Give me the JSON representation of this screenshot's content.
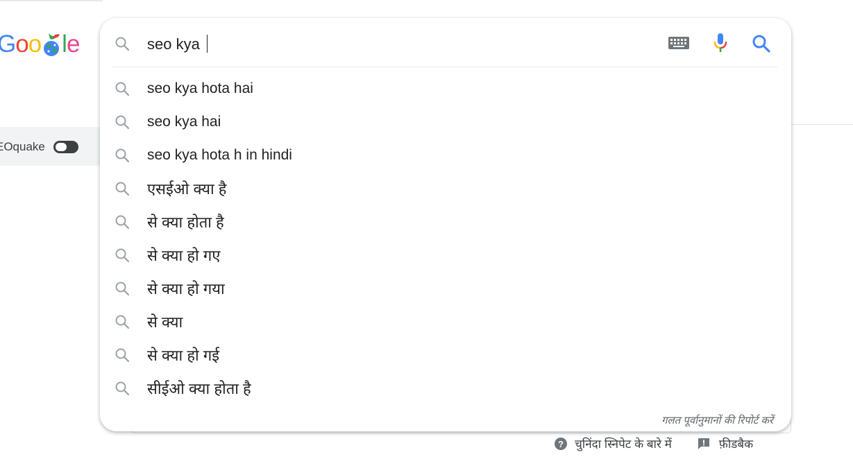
{
  "logo": {
    "g": "G",
    "o1": "o",
    "o2": "o",
    "l": "l",
    "e": "e",
    "doodle_icon": "earth-doodle-icon"
  },
  "sidebar": {
    "extension_label": "EOquake",
    "toggle_state": "off"
  },
  "search": {
    "query": "seo kya ",
    "keyboard_icon": "keyboard-icon",
    "mic_icon": "microphone-icon",
    "submit_icon": "search-icon"
  },
  "suggestions": [
    {
      "text": "seo kya hota hai"
    },
    {
      "text": "seo kya hai"
    },
    {
      "text": "seo kya hota h in hindi"
    },
    {
      "text": "एसईओ क्या है"
    },
    {
      "text": "से क्या होता है"
    },
    {
      "text": "से क्या हो गए"
    },
    {
      "text": "से क्या हो गया"
    },
    {
      "text": "से क्या"
    },
    {
      "text": "से क्या हो गई"
    },
    {
      "text": "सीईओ क्या होता है"
    }
  ],
  "report_link": "गलत पूर्वानुमानों की रिपोर्ट करें",
  "footer": {
    "snippet_info": "चुनिंदा स्निपेट के बारे में",
    "feedback": "फ़ीडबैक"
  },
  "colors": {
    "blue": "#4285f4",
    "red": "#ea4335",
    "yellow": "#fbbc05",
    "green": "#34a853"
  }
}
